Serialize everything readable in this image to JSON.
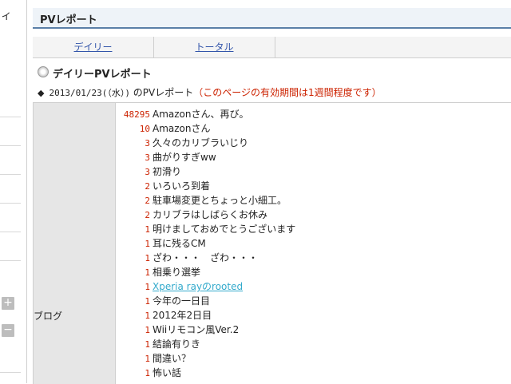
{
  "sidebar": {
    "curl_glyph": "ィ",
    "plus_glyph": "+",
    "minus_glyph": "−"
  },
  "page": {
    "title": "PVレポート"
  },
  "tabs": [
    {
      "label": "デイリー"
    },
    {
      "label": "トータル"
    }
  ],
  "section": {
    "heading": "デイリーPVレポート"
  },
  "report": {
    "bullet": "◆",
    "date": "2013/01/23(（水）)",
    "suffix": "のPVレポート",
    "notice": "（このページの有効期間は1週間程度です）",
    "category": "ブログ",
    "rows": [
      {
        "count": "48295",
        "title": "Amazonさん、再び。"
      },
      {
        "count": "10",
        "title": "Amazonさん"
      },
      {
        "count": "3",
        "title": "久々のカリブラいじり"
      },
      {
        "count": "3",
        "title": "曲がりすぎww"
      },
      {
        "count": "3",
        "title": "初滑り"
      },
      {
        "count": "2",
        "title": "いろいろ到着"
      },
      {
        "count": "2",
        "title": "駐車場変更とちょっと小細工。"
      },
      {
        "count": "2",
        "title": "カリブラはしばらくお休み"
      },
      {
        "count": "1",
        "title": "明けましておめでとうございます"
      },
      {
        "count": "1",
        "title": "耳に残るCM"
      },
      {
        "count": "1",
        "title": "ざわ・・・　ざわ・・・"
      },
      {
        "count": "1",
        "title": "相乗り選挙"
      },
      {
        "count": "1",
        "title": "Xperia rayのrooted"
      },
      {
        "count": "1",
        "title": "今年の一日目"
      },
      {
        "count": "1",
        "title": "2012年2日目"
      },
      {
        "count": "1",
        "title": "Wiiリモコン風Ver.2"
      },
      {
        "count": "1",
        "title": "結論有りき"
      },
      {
        "count": "1",
        "title": "間違い？"
      },
      {
        "count": "1",
        "title": "怖い話"
      }
    ]
  }
}
